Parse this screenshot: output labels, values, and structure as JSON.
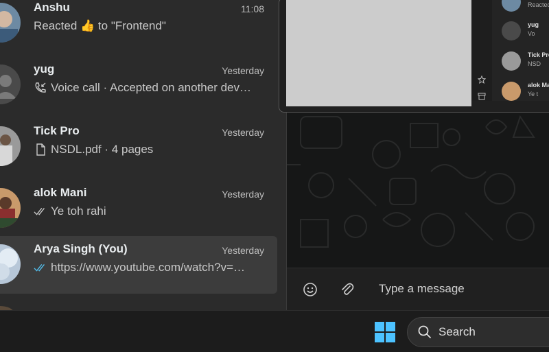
{
  "chat_list": {
    "items": [
      {
        "name": "Anshu",
        "time": "11:08",
        "preview": "Reacted 👍 to \"Frontend\"",
        "preview_icon": "none",
        "avatar": "photo-blue"
      },
      {
        "name": "yug",
        "time": "Yesterday",
        "preview": "Voice call · Accepted on another dev…",
        "preview_icon": "incoming-call-icon",
        "avatar": "default-person"
      },
      {
        "name": "Tick Pro",
        "time": "Yesterday",
        "preview": "NSDL.pdf · 4 pages",
        "preview_icon": "document-icon",
        "avatar": "photo-gray"
      },
      {
        "name": "alok Mani",
        "time": "Yesterday",
        "preview": "Ye toh rahi",
        "preview_icon": "double-check-icon",
        "avatar": "photo-orange"
      },
      {
        "name": "Arya Singh (You)",
        "time": "Yesterday",
        "preview": "https://www.youtube.com/watch?v=…",
        "preview_icon": "double-check-blue-icon",
        "avatar": "photo-sky",
        "selected": true
      }
    ]
  },
  "thumbnail_preview": {
    "items": [
      {
        "name": "",
        "sub": "Reacted"
      },
      {
        "name": "yug",
        "sub": "Vo"
      },
      {
        "name": "Tick Pro",
        "sub": "NSD"
      },
      {
        "name": "alok Ma",
        "sub": "Ye t"
      }
    ]
  },
  "composer": {
    "placeholder": "Type a message"
  },
  "taskbar": {
    "search_label": "Search"
  },
  "colors": {
    "read_receipt_blue": "#53bdeb",
    "win_blue": "#4cc2ff"
  }
}
